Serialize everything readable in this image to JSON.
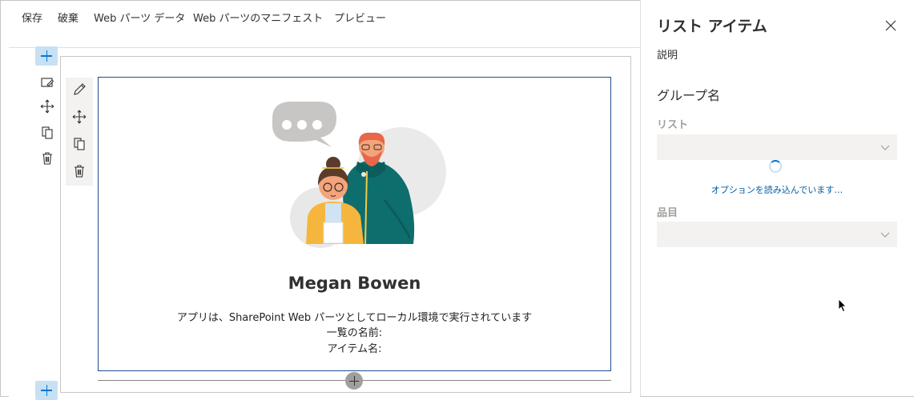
{
  "commandbar": {
    "save": "保存",
    "discard": "破棄",
    "webpart_data": "Web パーツ データ",
    "webpart_manifest": "Web パーツのマニフェスト",
    "preview": "プレビュー"
  },
  "webpart": {
    "name": "Megan Bowen",
    "line1": "アプリは、SharePoint Web パーツとしてローカル環境で実行されています",
    "line2": "一覧の名前:",
    "line3": "アイテム名:"
  },
  "pane": {
    "title": "リスト アイテム",
    "description": "説明",
    "group_name": "グループ名",
    "list_label": "リスト",
    "list_value": "",
    "loading_text": "オプションを読み込んでいます…",
    "item_label": "品目",
    "item_value": ""
  },
  "colors": {
    "accent": "#0078d4",
    "webpart_border": "#1f4e8c",
    "disabled_label": "#a19f9d",
    "field_bg": "#f3f2f1"
  },
  "icons": [
    "edit-icon",
    "move-icon",
    "copy-icon",
    "delete-icon",
    "close-icon",
    "chevron-down-icon",
    "add-icon"
  ]
}
